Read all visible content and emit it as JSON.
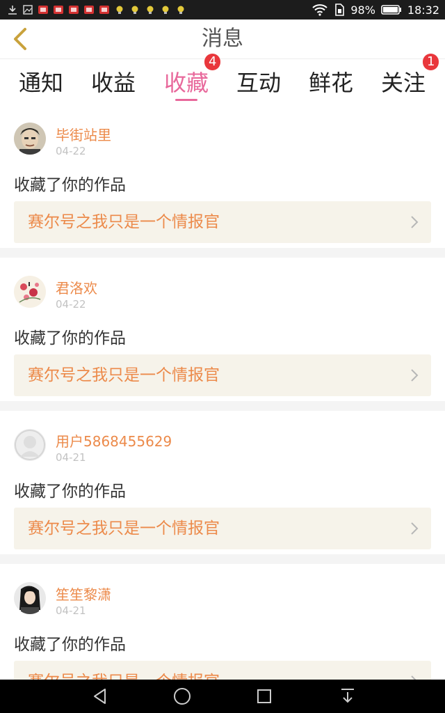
{
  "status_bar": {
    "battery": "98%",
    "time": "18:32"
  },
  "header": {
    "title": "消息"
  },
  "tabs": [
    {
      "label": "通知",
      "badge": ""
    },
    {
      "label": "收益",
      "badge": ""
    },
    {
      "label": "收藏",
      "badge": "4",
      "active": true
    },
    {
      "label": "互动",
      "badge": ""
    },
    {
      "label": "鲜花",
      "badge": ""
    },
    {
      "label": "关注",
      "badge": "1"
    }
  ],
  "messages": [
    {
      "username": "毕街站里",
      "date": "04-22",
      "action": "收藏了你的作品",
      "work": "赛尔号之我只是一个情报官"
    },
    {
      "username": "君洛欢",
      "date": "04-22",
      "action": "收藏了你的作品",
      "work": "赛尔号之我只是一个情报官"
    },
    {
      "username": "用户5868455629",
      "date": "04-21",
      "action": "收藏了你的作品",
      "work": "赛尔号之我只是一个情报官"
    },
    {
      "username": "笙笙黎潇",
      "date": "04-21",
      "action": "收藏了你的作品",
      "work": "赛尔号之我只是一个情报官"
    }
  ],
  "colors": {
    "accent": "#e8689b",
    "name": "#ec8a4a",
    "badge": "#e9373c",
    "back": "#c9a23c"
  }
}
